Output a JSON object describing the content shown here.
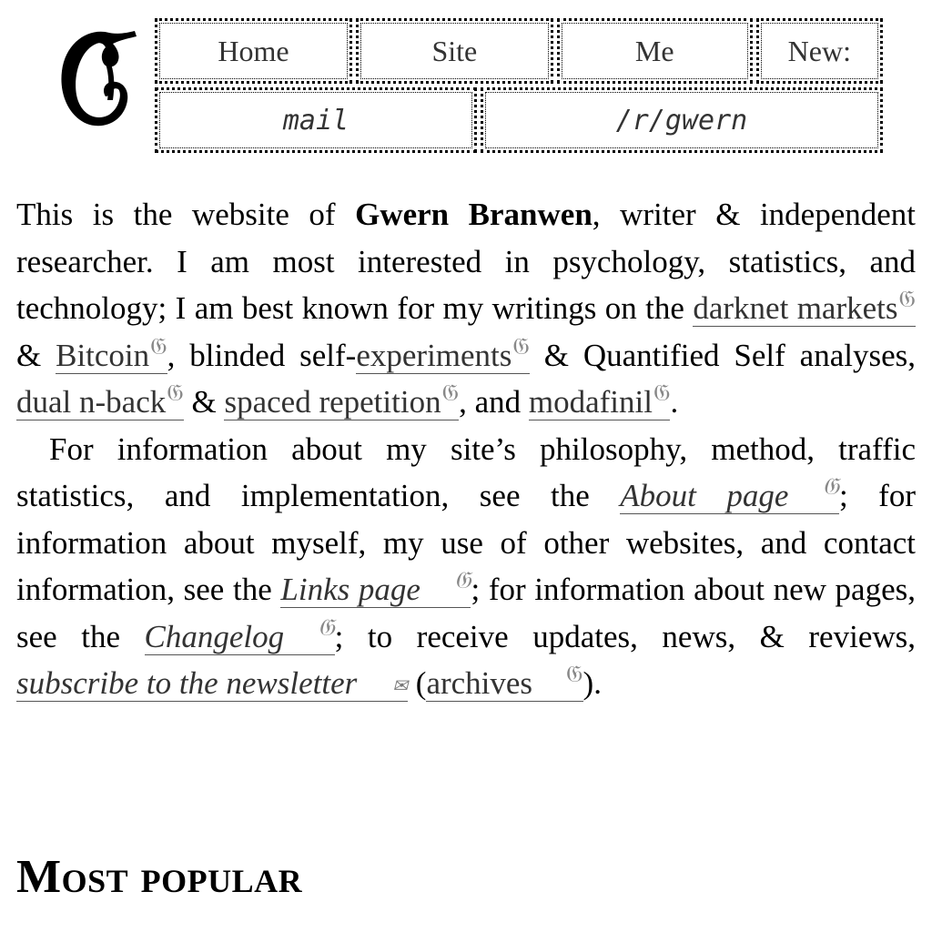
{
  "nav": {
    "row1": [
      "Home",
      "Site",
      "Me",
      "New:"
    ],
    "row2": [
      "mail",
      "/r/gwern"
    ]
  },
  "intro": {
    "p1_a": "This is the website of ",
    "name": "Gwern Branwen",
    "p1_b": ", writer & independent researcher. I am most interested in psychology, statistics, and technology; I am best known for my writings on the ",
    "link_darknet": "darknet markets",
    "p1_c": " & ",
    "link_bitcoin": "Bitcoin",
    "p1_d": ", blinded self-",
    "link_experiments": "experiments",
    "p1_e": " & Quantified Self analyses, ",
    "link_dnb": "dual n-back",
    "p1_f": " & ",
    "link_spaced": "spaced repetition",
    "p1_g": ", and ",
    "link_modafinil": "modafinil",
    "p1_h": "."
  },
  "info": {
    "p2_a": "For information about my site’s philosophy, method, traffic statistics, and implementation, see the ",
    "link_about": "About page",
    "p2_b": "; for information about myself, my use of other websites, and contact information, see the ",
    "link_links": "Links page",
    "p2_c": "; for information about new pages, see the ",
    "link_changelog": "Changelog",
    "p2_d": "; to receive updates, news, & reviews, ",
    "link_newsletter": "subscribe to the newsletter",
    "p2_e": " (",
    "link_archives": "archives",
    "p2_f": ")."
  },
  "section": {
    "title": "Most popular"
  },
  "icons": {
    "gwern": "gwern-g-icon",
    "mail": "envelope-icon"
  }
}
